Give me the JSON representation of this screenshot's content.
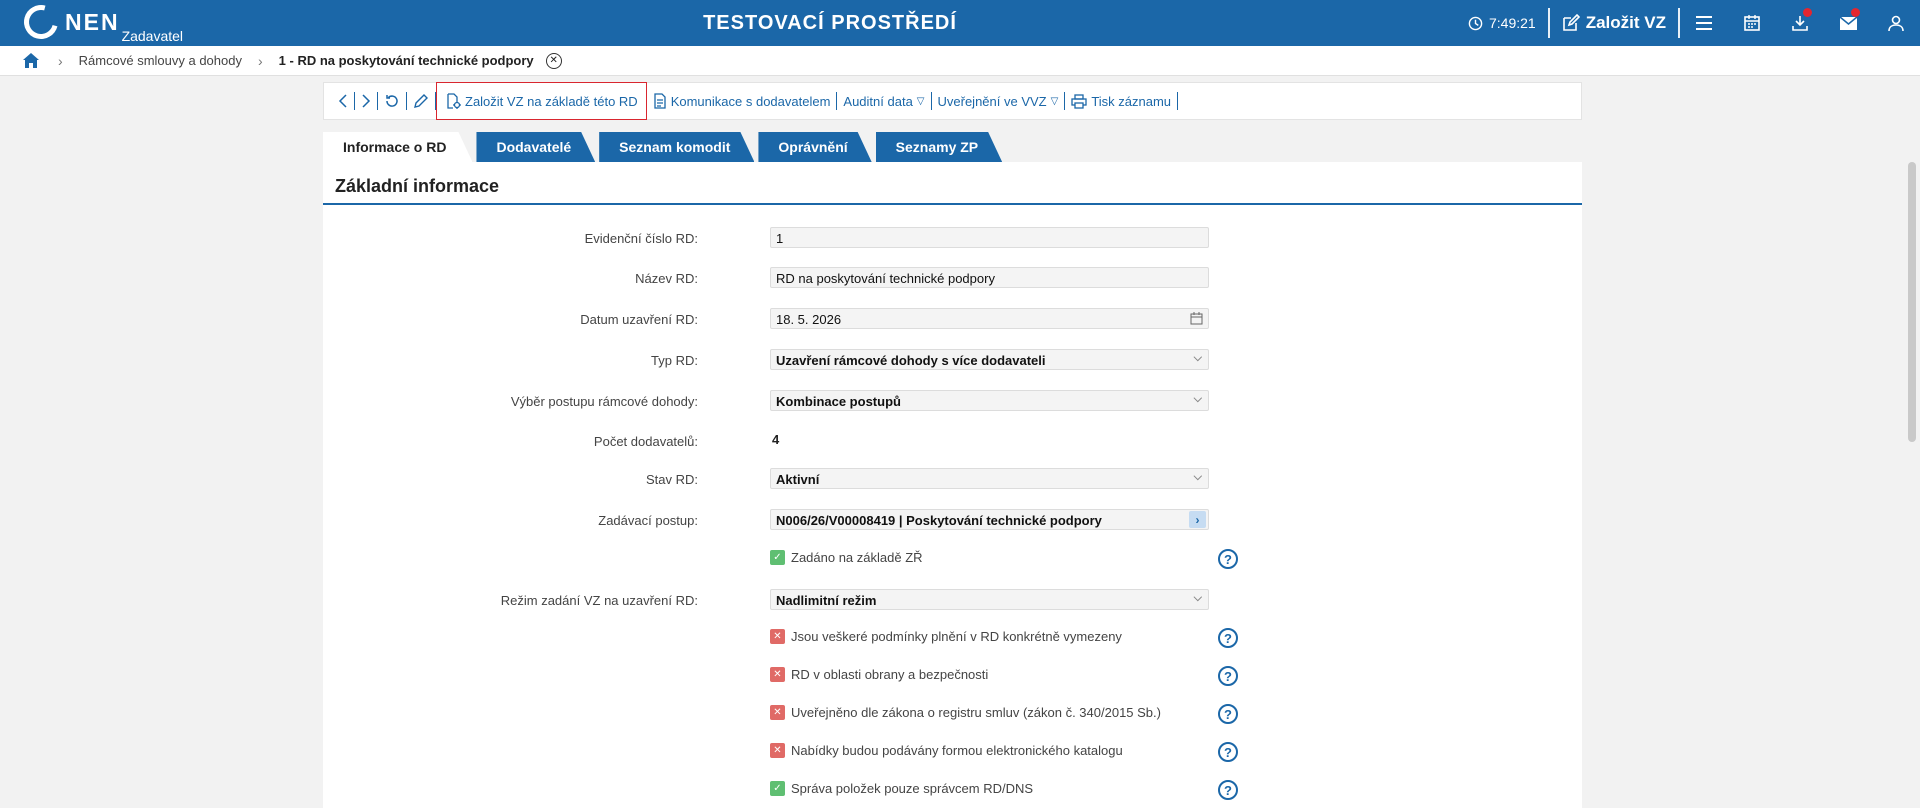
{
  "header": {
    "logo_text": "NEN",
    "logo_sub": "Zadavatel",
    "env_title": "TESTOVACÍ PROSTŘEDÍ",
    "clock": "7:49:21",
    "new_vz_label": "Založit VZ"
  },
  "breadcrumb": {
    "items": [
      "Rámcové smlouvy a dohody",
      "1 - RD na poskytování technické podpory"
    ]
  },
  "toolbar": {
    "create_vz": "Založit VZ na základě této RD",
    "communication": "Komunikace s dodavatelem",
    "audit": "Auditní data",
    "publish": "Uveřejnění ve VVZ",
    "print": "Tisk záznamu"
  },
  "tabs": [
    "Informace o RD",
    "Dodavatelé",
    "Seznam komodit",
    "Oprávnění",
    "Seznamy ZP"
  ],
  "section": {
    "title": "Základní informace"
  },
  "fields": {
    "evidencni_label": "Evidenční číslo RD:",
    "evidencni_value": "1",
    "nazev_label": "Název RD:",
    "nazev_value": "RD na poskytování technické podpory",
    "datum_label": "Datum uzavření RD:",
    "datum_value": "18. 5. 2026",
    "typ_label": "Typ RD:",
    "typ_value": "Uzavření rámcové dohody s více dodavateli",
    "vyber_label": "Výběr postupu rámcové dohody:",
    "vyber_value": "Kombinace postupů",
    "pocet_label": "Počet dodavatelů:",
    "pocet_value": "4",
    "stav_label": "Stav RD:",
    "stav_value": "Aktivní",
    "postup_label": "Zadávací postup:",
    "postup_value": "N006/26/V00008419 | Poskytování technické podpory",
    "zr_label": "Zadáno na základě ZŘ",
    "rezim_label": "Režim zadání VZ na uzavření RD:",
    "rezim_value": "Nadlimitní režim"
  },
  "checks": [
    {
      "label": "Jsou veškeré podmínky plnění v RD konkrétně vymezeny",
      "checked": false
    },
    {
      "label": "RD v oblasti obrany a bezpečnosti",
      "checked": false
    },
    {
      "label": "Uveřejněno dle zákona o registru smluv (zákon č. 340/2015 Sb.)",
      "checked": false
    },
    {
      "label": "Nabídky budou podávány formou elektronického katalogu",
      "checked": false
    },
    {
      "label": "Správa položek pouze správcem RD/DNS",
      "checked": true
    }
  ]
}
